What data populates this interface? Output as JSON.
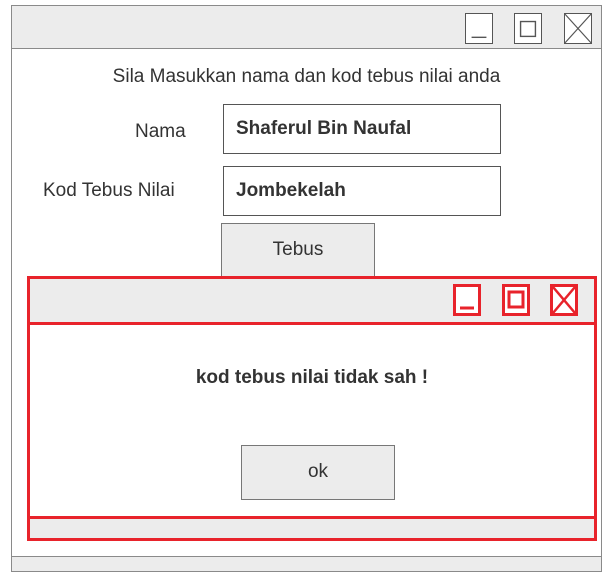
{
  "main_window": {
    "instruction": "Sila Masukkan nama dan kod tebus nilai anda",
    "nama_label": "Nama",
    "nama_value": "Shaferul Bin Naufal",
    "kod_label": "Kod Tebus Nilai",
    "kod_value": "Jombekelah",
    "tebus_button": "Tebus",
    "controls": [
      "minimize-icon",
      "maximize-icon",
      "close-icon"
    ]
  },
  "dialog": {
    "message": "kod tebus nilai tidak sah !",
    "ok_button": "ok",
    "controls": [
      "minimize-icon",
      "maximize-icon",
      "close-icon"
    ],
    "accent_color": "#e8232b"
  }
}
